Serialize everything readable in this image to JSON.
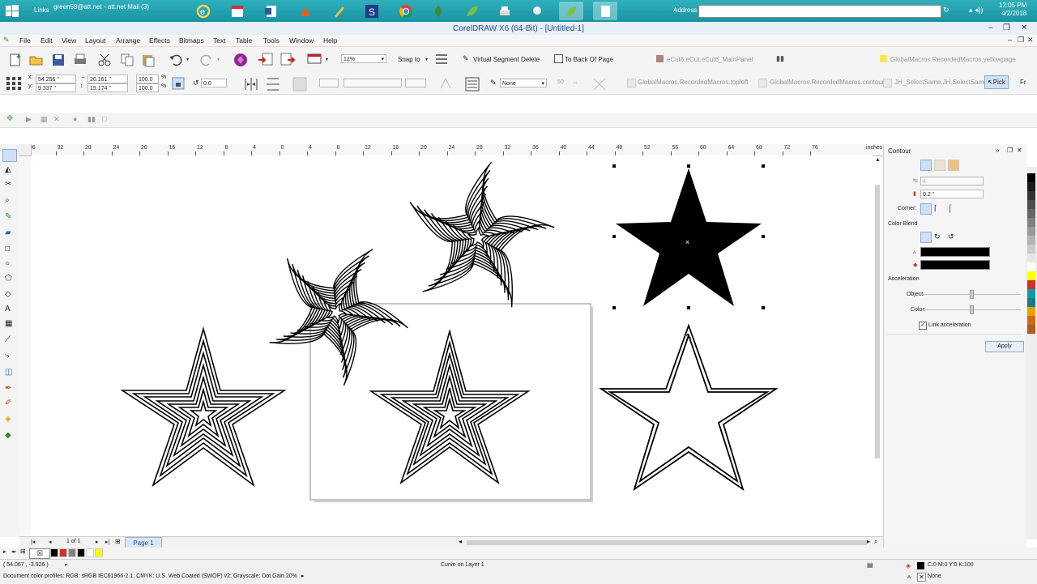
{
  "taskbar": {
    "links_label": "Links",
    "mail_label": "green58@att.net - att.net Mail (3)",
    "address_label": "Address",
    "address_value": "",
    "clock_time": "12:05 PM",
    "clock_date": "4/2/2018",
    "apps": [
      "ie-icon",
      "calendar-icon",
      "word-icon",
      "app-icon",
      "pen-icon",
      "s-icon",
      "chrome-icon",
      "corel-icon",
      "leaf-icon",
      "printer-icon",
      "tool-icon",
      "corel-active-icon",
      "document-icon"
    ]
  },
  "title": "CorelDRAW X6 (64-Bit) - [Untitled-1]",
  "menu": [
    "File",
    "Edit",
    "View",
    "Layout",
    "Arrange",
    "Effects",
    "Bitmaps",
    "Text",
    "Table",
    "Tools",
    "Window",
    "Help"
  ],
  "toolbar1": {
    "zoom": "12%",
    "snap_to": "Snap to",
    "virtual_segment_delete": "Virtual Segment Delete",
    "to_back_of_page": "To Back Of Page",
    "macro_main_panel": "eCut6.eCut.eCut6_MainPanel",
    "macro_yellowpage": "GlobalMacros.RecordedMacros.yellowpage"
  },
  "toolbar2": {
    "x": "54.256 \"",
    "y": "9.337 \"",
    "width": "20.161 \"",
    "height": "19.174 \"",
    "scale_x": "100.0",
    "scale_y": "100.0",
    "percent": "%",
    "angle": "0.0",
    "outline": "None",
    "value_50": "50",
    "macro_topleft": "GlobalMacros.RecordedMacros.topleft",
    "macro_contour": "GlobalMacros.RecordedMacros.contour",
    "macro_selectsame": "JH_SelectSame.JH.SelectSame",
    "pick": "Pick",
    "fr": "Fr"
  },
  "ruler": {
    "h_ticks": [
      "36",
      "32",
      "28",
      "24",
      "20",
      "16",
      "12",
      "8",
      "4",
      "0",
      "4",
      "8",
      "12",
      "16",
      "20",
      "24",
      "28",
      "32",
      "36",
      "40",
      "44",
      "48",
      "52",
      "56",
      "60",
      "64",
      "68",
      "72",
      "76"
    ],
    "unit": "inches"
  },
  "docker": {
    "title": "Contour",
    "steps": "4",
    "offset": "0.2 \"",
    "corner_label": "Corner:",
    "color_blend_label": "Color Blend",
    "acceleration_label": "Acceleration",
    "object_label": "Object:",
    "color_label": "Color:",
    "link_acceleration": "Link acceleration",
    "apply": "Apply"
  },
  "pagebar": {
    "page_count": "1 of 1",
    "page_tab": "Page 1"
  },
  "status": {
    "coords": "( 54.067 , -3.926 )",
    "object_info": "Curve on Layer 1",
    "fill_info": "C:0 M:0 Y:0 K:100",
    "outline_info": "None",
    "color_profiles": "Document color profiles: RGB: sRGB IEC61966-2.1; CMYK: U.S. Web Coated (SWOP) v2; Grayscale: Dot Gain 20%"
  },
  "colors": {
    "accent": "#1f4e9e",
    "taskbar": "#1993a2",
    "selection_handle": "#000000"
  },
  "palette_colors": [
    "#000000",
    "#1a1a1a",
    "#333333",
    "#4d4d4d",
    "#666666",
    "#808080",
    "#999999",
    "#b3b3b3",
    "#cccccc",
    "#e6e6e6",
    "#ffffff",
    "#ffff00",
    "#d0312d",
    "#0f9aa8",
    "#1b7a8a",
    "#e5a300",
    "#cc6a1a",
    "#b35a1e"
  ],
  "swatch_colors": [
    "#000000",
    "#d0312d",
    "#808080",
    "#000000",
    "#ffffff",
    "#ffff00"
  ]
}
